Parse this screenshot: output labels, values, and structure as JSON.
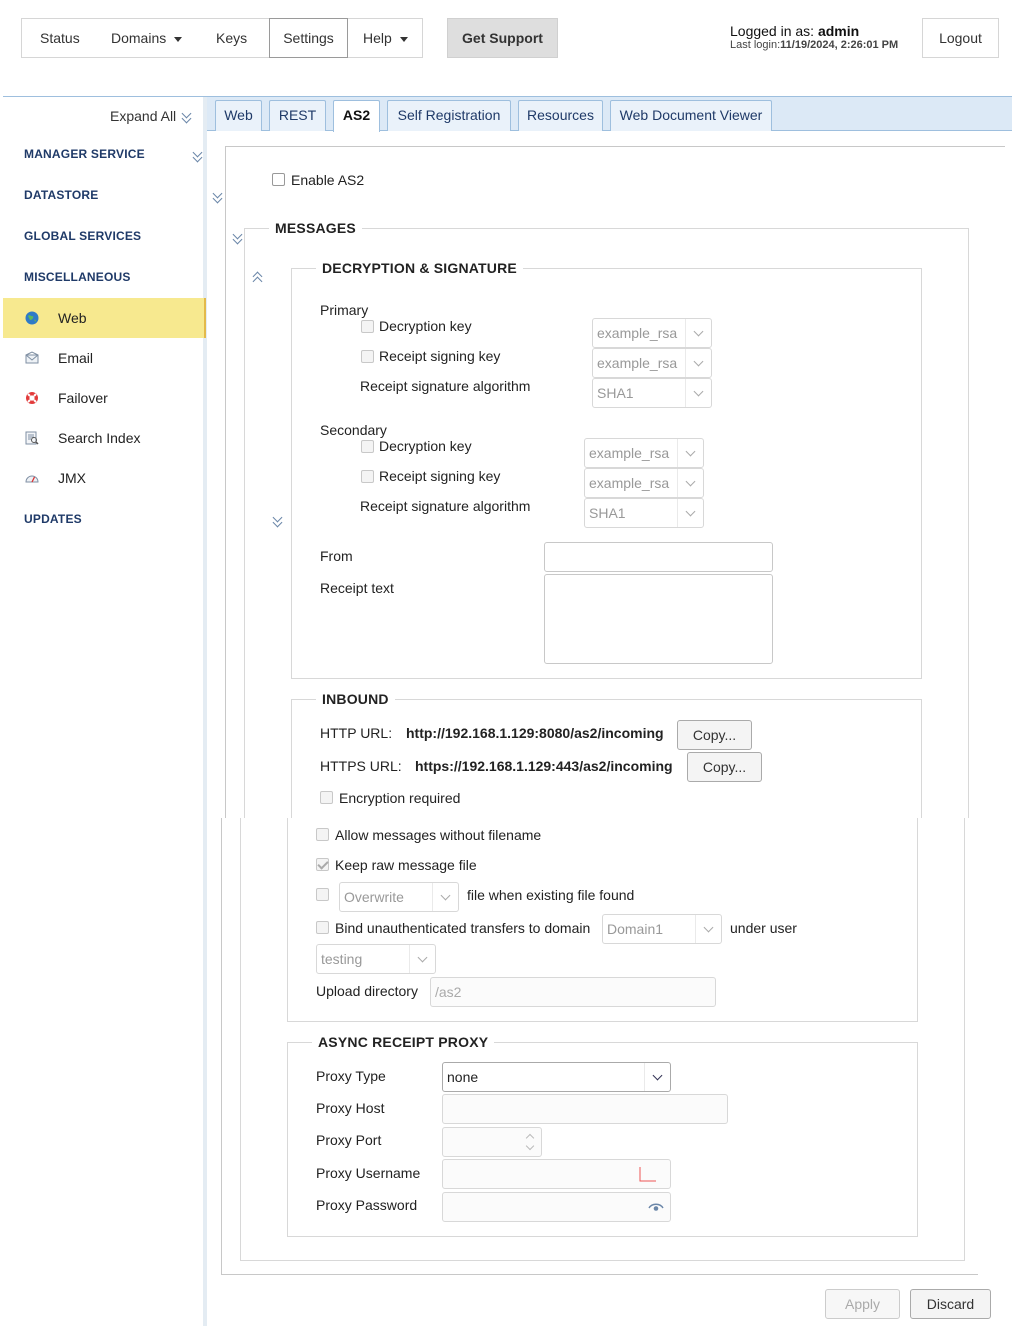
{
  "nav": {
    "items": [
      {
        "label": "Status"
      },
      {
        "label": "Domains"
      },
      {
        "label": "Keys"
      },
      {
        "label": "Settings"
      },
      {
        "label": "Help"
      }
    ],
    "get_support": "Get Support",
    "logged_in_prefix": "Logged in as:",
    "user": "admin",
    "last_login_prefix": "Last login:",
    "last_login_value": "11/19/2024, 2:26:01 PM",
    "logout": "Logout"
  },
  "sidebar": {
    "expand_all": "Expand All",
    "sections": {
      "manager": "MANAGER SERVICE",
      "datastore": "DATASTORE",
      "global": "GLOBAL SERVICES",
      "misc": "MISCELLANEOUS",
      "updates": "UPDATES"
    },
    "items": [
      {
        "label": "Web",
        "icon": "globe-icon"
      },
      {
        "label": "Email",
        "icon": "envelope-icon"
      },
      {
        "label": "Failover",
        "icon": "lifebuoy-icon"
      },
      {
        "label": "Search Index",
        "icon": "search-index-icon"
      },
      {
        "label": "JMX",
        "icon": "gauge-icon"
      }
    ]
  },
  "tabs": [
    "Web",
    "REST",
    "AS2",
    "Self Registration",
    "Resources",
    "Web Document Viewer"
  ],
  "active_tab": "AS2",
  "form": {
    "enable_as2": "Enable AS2",
    "messages_legend": "MESSAGES",
    "decryption": {
      "legend": "DECRYPTION & SIGNATURE",
      "primary_label": "Primary",
      "secondary_label": "Secondary",
      "decryption_key": "Decryption key",
      "receipt_signing_key": "Receipt signing key",
      "receipt_algorithm": "Receipt signature algorithm",
      "primary_decryption_value": "example_rsa",
      "primary_signing_value": "example_rsa",
      "primary_algorithm_value": "SHA1",
      "secondary_decryption_value": "example_rsa",
      "secondary_signing_value": "example_rsa",
      "secondary_algorithm_value": "SHA1",
      "from_label": "From",
      "receipt_text_label": "Receipt text"
    },
    "inbound": {
      "legend": "INBOUND",
      "http_label": "HTTP URL:",
      "http_value": "http://192.168.1.129:8080/as2/incoming",
      "https_label": "HTTPS URL:",
      "https_value": "https://192.168.1.129:443/as2/incoming",
      "copy": "Copy...",
      "encryption_required": "Encryption required",
      "allow_without_filename": "Allow messages without filename",
      "keep_raw": "Keep raw message file",
      "overwrite_value": "Overwrite",
      "overwrite_suffix": "file when existing file found",
      "bind_label": "Bind unauthenticated transfers to domain",
      "domain_value": "Domain1",
      "under_user": "under user",
      "user_value": "testing",
      "upload_dir_label": "Upload directory",
      "upload_dir_placeholder": "/as2"
    },
    "async": {
      "legend": "ASYNC RECEIPT PROXY",
      "proxy_type_label": "Proxy Type",
      "proxy_type_value": "none",
      "proxy_host_label": "Proxy Host",
      "proxy_port_label": "Proxy Port",
      "proxy_username_label": "Proxy Username",
      "proxy_password_label": "Proxy Password"
    }
  },
  "footer": {
    "apply": "Apply",
    "discard": "Discard"
  }
}
